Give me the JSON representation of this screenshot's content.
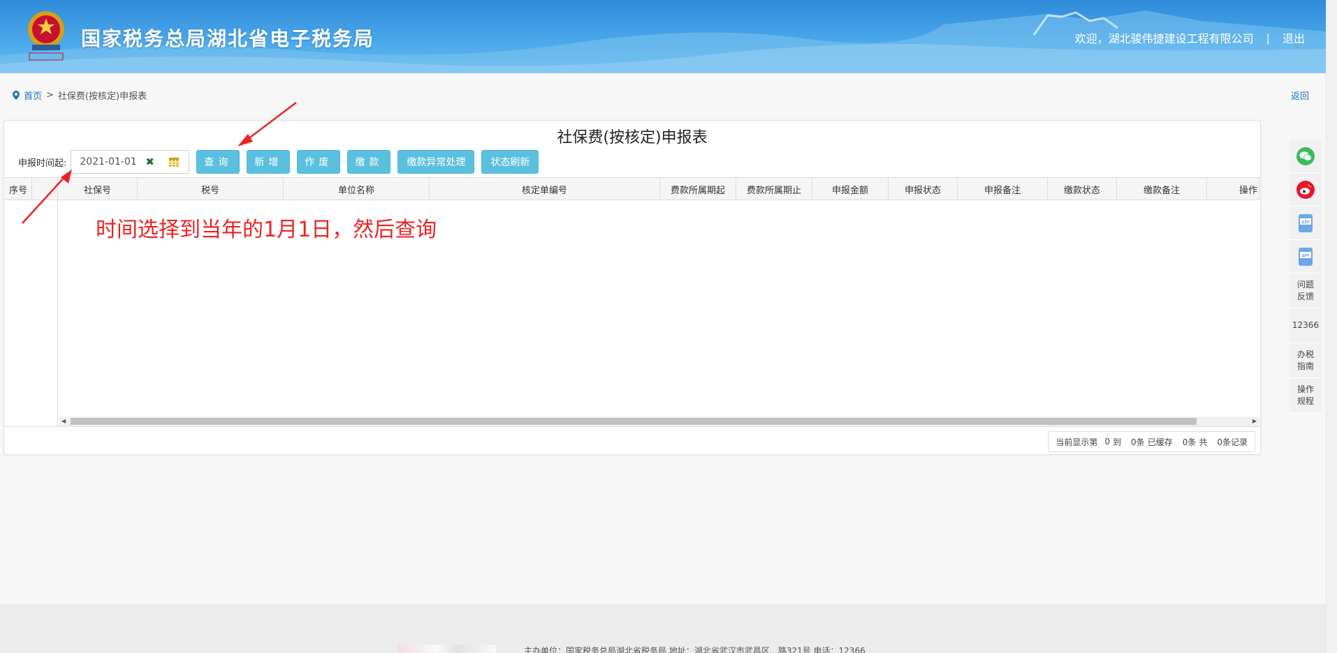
{
  "header": {
    "site_title": "国家税务总局湖北省电子税务局",
    "welcome": "欢迎，",
    "company": "湖北骏伟捷建设工程有限公司",
    "separator": "|",
    "logout": "退出"
  },
  "breadcrumb": {
    "home": "首页",
    "arrow": ">",
    "current": "社保费(按核定)申报表",
    "back": "返回"
  },
  "panel": {
    "title": "社保费(按核定)申报表",
    "date_label": "申报时间起:",
    "date_value": "2021-01-01",
    "buttons": {
      "query": "查询",
      "add": "新增",
      "void": "作废",
      "pay": "缴款",
      "pay_exception": "缴款异常处理",
      "status_refresh": "状态刷新"
    }
  },
  "grid": {
    "columns": [
      "序号",
      "",
      "社保号",
      "税号",
      "单位名称",
      "核定单编号",
      "费款所属期起",
      "费款所属期止",
      "申报金额",
      "申报状态",
      "申报备注",
      "缴款状态",
      "缴款备注",
      "操作"
    ],
    "rows": []
  },
  "annotation": "时间选择到当年的1月1日，然后查询",
  "pager": {
    "t1": "当前显示第",
    "from": "0",
    "t2": "到",
    "to": "0条",
    "t3": "已缓存",
    "cached": "0条",
    "t4": "共",
    "total": "0条记录"
  },
  "side_tools": {
    "wechat": "wechat",
    "weibo": "weibo",
    "app1": "APP",
    "app2": "APP",
    "feedback": "问题反馈",
    "hotline": "12366",
    "guide": "办税指南",
    "rules": "操作规程"
  },
  "footer": {
    "text": "主办单位：国家税务总局湖北省税务局  地址：湖北省武汉市武昌区…路321号  电话：12366"
  },
  "colors": {
    "header_blue": "#3a9ae3",
    "button_info": "#5bc0de",
    "annotation_red": "#ee2222",
    "link_blue": "#1f73c1"
  }
}
